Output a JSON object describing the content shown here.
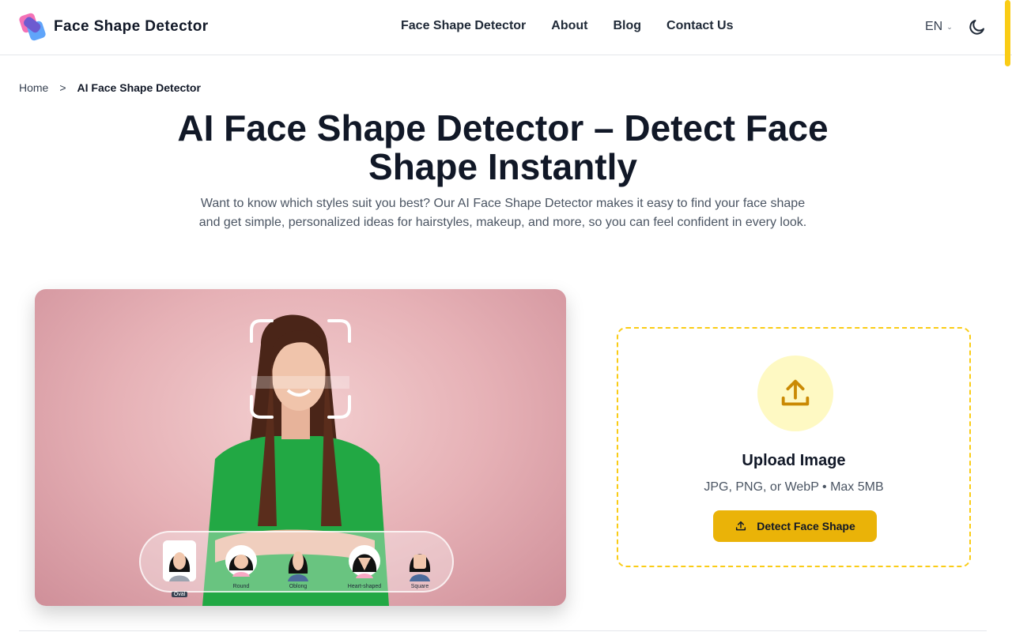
{
  "brand": {
    "name": "Face Shape Detector"
  },
  "nav": {
    "items": [
      "Face Shape Detector",
      "About",
      "Blog",
      "Contact Us"
    ]
  },
  "lang": {
    "current": "EN"
  },
  "breadcrumb": {
    "home": "Home",
    "separator": ">",
    "current": "AI Face Shape Detector"
  },
  "hero": {
    "title_line1": "AI Face Shape Detector – Detect Face",
    "title_line2": "Shape Instantly",
    "subtitle": "Want to know which styles suit you best? Our AI Face Shape Detector makes it easy to find your face shape and get simple, personalized ideas for hairstyles, makeup, and more, so you can feel confident in every look."
  },
  "shapes": [
    "Oval",
    "Round",
    "Oblong",
    "Heart-shaped",
    "Square"
  ],
  "upload": {
    "title": "Upload Image",
    "hint": "JPG, PNG, or WebP • Max 5MB",
    "button_label": "Detect Face Shape"
  },
  "colors": {
    "accent": "#eab308",
    "accent_light": "#fef9c3",
    "dashed_border": "#facc15"
  }
}
